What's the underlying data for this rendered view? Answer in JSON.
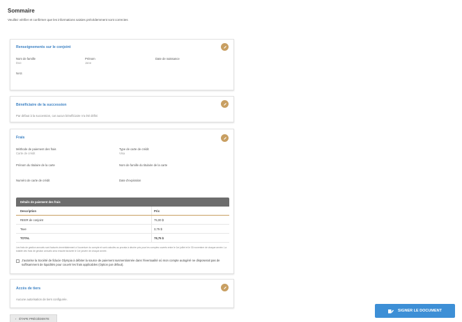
{
  "summary": {
    "title": "Sommaire",
    "subtitle": "Veuillez vérifier et confirmer que les informations saisies précédemment sont correctes"
  },
  "spouse": {
    "title": "Renseignements sur le conjoint",
    "last_name_label": "Nom de famille",
    "last_name_value": "Doe",
    "first_name_label": "Prénom",
    "first_name_value": "Jane",
    "dob_label": "Date de naissance",
    "dob_value": "",
    "nas_label": "NAS",
    "nas_value": ""
  },
  "beneficiary": {
    "title": "Bénéficiaire de la succession",
    "text": "Par défaut à la succession, car aucun bénéficiaire n'a été défini"
  },
  "fees": {
    "title": "Frais",
    "payment_method_label": "Méthode de paiement des frais",
    "payment_method_value": "Carte de crédit",
    "card_type_label": "Type de carte de crédit",
    "card_type_value": "Visa",
    "holder_first_label": "Prénom du titulaire de la carte",
    "holder_last_label": "Nom de famille du titulaire de la carte",
    "card_number_label": "Numéro de carte de crédit",
    "expiry_label": "Date d'expiration",
    "table_title": "Détails de paiement des frais",
    "col_description": "Description",
    "col_price": "Prix",
    "rows": [
      {
        "description": "REER de conjoint",
        "price": "75,00 $"
      },
      {
        "description": "Taxe",
        "price": "3,75 $"
      },
      {
        "description": "TOTAL",
        "price": "78,75 $"
      }
    ],
    "note": "Les frais de gestion annuels sont facturés immédiatement à l'ouverture du compte et sont calculés au prorata à décrire pris pour les comptes ouverts entre le 1er juillet et le 30 novembre de chaque année. La totalité des frais de gestion annuels sera ensuite facturée le 1er janvier de chaque année.",
    "authorize_text": "J'autorise la Société de fiducie Olympia à débiter la source de paiement susmentionnée dans l'éventualité où mon compte autogéré ne disposerait pas de suffisamment de liquidités pour couvrir les frais applicables (Option par défaut)."
  },
  "third_party": {
    "title": "Accès de tiers",
    "text": "Aucune autorisation de tiers configurée."
  },
  "actions": {
    "sign_label": "SIGNER LE DOCUMENT",
    "prev_label": "ÉTAPE PRÉCÉDENTE"
  },
  "colors": {
    "accent_blue": "#3d82c4",
    "edit_gold": "#c89f62",
    "sign_button": "#3d8fd6",
    "table_header": "#6d6d6d"
  },
  "icons": [
    "pencil-icon",
    "sign-document-icon",
    "chevron-left-icon"
  ]
}
